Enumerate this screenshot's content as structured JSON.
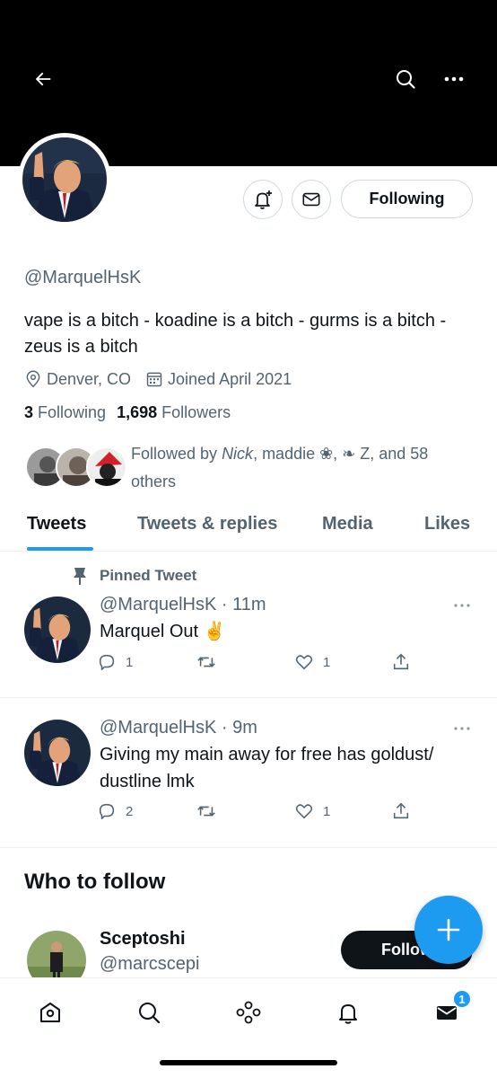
{
  "profile": {
    "handle": "@MarquelHsK",
    "bio": "vape is a bitch - koadine is a bitch - gurms is a bitch - zeus is a bitch",
    "location": "Denver, CO",
    "joined": "Joined April 2021",
    "following_count": "3",
    "following_label": "Following",
    "followers_count": "1,698",
    "followers_label": "Followers",
    "followed_by": {
      "prefix": "Followed by ",
      "name1": "Nick",
      "rest": ", maddie ❀, ❧ Z, and 58 others"
    }
  },
  "header": {
    "back_icon": "arrow-left-icon",
    "search_icon": "search-icon",
    "more_icon": "more-horizontal-icon"
  },
  "actions": {
    "following_label": "Following"
  },
  "tabs": [
    {
      "label": "Tweets",
      "active": true
    },
    {
      "label": "Tweets & replies",
      "active": false
    },
    {
      "label": "Media",
      "active": false
    },
    {
      "label": "Likes",
      "active": false
    }
  ],
  "tweets": [
    {
      "pinned_label": "Pinned Tweet",
      "handle": "@MarquelHsK",
      "time": "· 11m",
      "text": "Marquel Out ✌️",
      "replies": "1",
      "retweets": "",
      "likes": "1"
    },
    {
      "handle": "@MarquelHsK",
      "time": "· 9m",
      "text": "Giving my main away for free has goldust/ dustline lmk",
      "replies": "2",
      "retweets": "",
      "likes": "1"
    }
  ],
  "who_to_follow": {
    "title": "Who to follow",
    "name": "Sceptoshi",
    "handle": "@marcscepi",
    "follow_label": "Follow"
  },
  "bottom_nav": {
    "items": [
      "home-icon",
      "search-icon",
      "spaces-icon",
      "notifications-icon",
      "messages-icon"
    ],
    "messages_badge": "1"
  },
  "colors": {
    "accent": "#1d9bf0",
    "text_primary": "#0f1419",
    "text_secondary": "#536471",
    "border": "#cfd9de"
  }
}
